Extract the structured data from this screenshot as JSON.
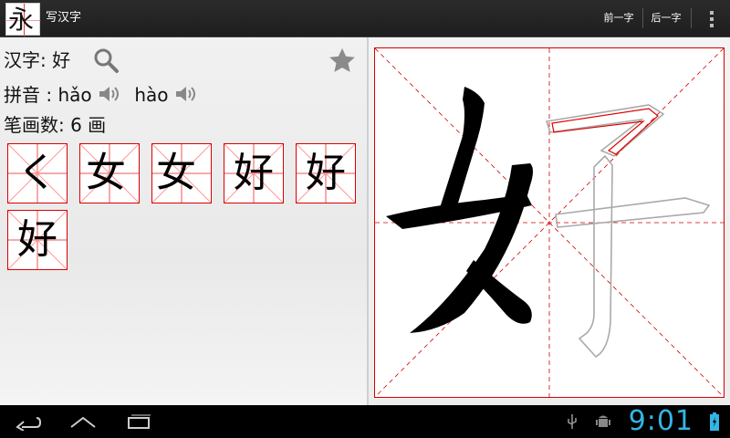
{
  "app": {
    "icon_glyph": "永",
    "title": "写汉字"
  },
  "actions": {
    "prev_label": "前一字",
    "next_label": "后一字",
    "overflow_icon": "overflow-menu-icon"
  },
  "info": {
    "character_label": "汉字: 好",
    "pinyin_label": "拼音 :",
    "pinyin_1": "hǎo",
    "pinyin_2": "hào",
    "strokes_label": "笔画数: 6 画"
  },
  "stroke_thumbs": [
    {
      "glyph": "く"
    },
    {
      "glyph": "女"
    },
    {
      "glyph": "女"
    },
    {
      "glyph": "好"
    },
    {
      "glyph": "好"
    },
    {
      "glyph": "好"
    }
  ],
  "canvas": {
    "drawn_part": "女",
    "outline_part": "子"
  },
  "status": {
    "time": "9:01"
  },
  "colors": {
    "accent": "#33b5e5",
    "grid": "#d40000",
    "highlight_stroke": "#e00000"
  }
}
